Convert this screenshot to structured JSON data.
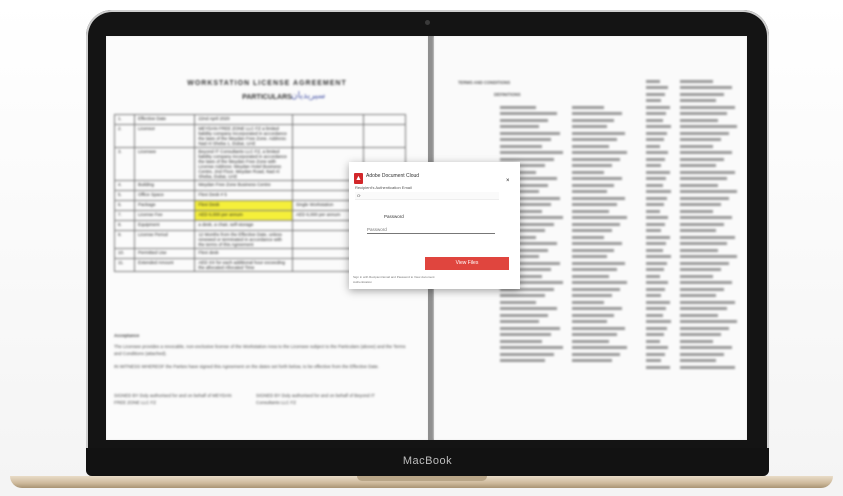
{
  "laptop": {
    "brand": "MacBook"
  },
  "document_left": {
    "title": "WORKSTATION LICENSE AGREEMENT",
    "subtitle": "PARTICULARS",
    "stamp": "سيريديان",
    "rows": [
      [
        "1.",
        "Effective Date",
        "22nd April 2020",
        "",
        ""
      ],
      [
        "2.",
        "Licensor",
        "MEYDAN FREE ZONE LLC FZ a limited liability company incorporated in accordance the laws of the Meydan Free Zone. Address: Nad Al Sheba 1, Dubai, UAE",
        "",
        ""
      ],
      [
        "3.",
        "Licensee",
        "Beyond IT Consultants LLC FZ, a limited liability company incorporated in accordance the laws of the Meydan Free Zone with License Address: Meydan Hotel Business Centre, 2nd Floor, Meydan Road, Nad Al Sheba, Dubai, UAE",
        "",
        ""
      ],
      [
        "4.",
        "Building",
        "Meydan Free Zone Business Centre",
        "",
        ""
      ],
      [
        "5.",
        "Office Space",
        "Flexi Desk # 5",
        "",
        ""
      ],
      [
        "6.",
        "Package",
        "Flexi Desk",
        "Single Workstation",
        ""
      ],
      [
        "7.",
        "License Fee",
        "AED 6,000 per annum",
        "AED 6,000 per annum",
        ""
      ],
      [
        "8.",
        "Equipment",
        "a desk, a chair, self-storage",
        "",
        ""
      ],
      [
        "9.",
        "License Period",
        "12 Months from the Effective Date, unless renewed or terminated in accordance with the terms of this Agreement",
        "",
        ""
      ],
      [
        "10.",
        "Permitted Use",
        "Flexi desk",
        "",
        ""
      ],
      [
        "11.",
        "Extended Amount",
        "AED XX for each additional hour exceeding the allocated Allocated Time",
        "",
        ""
      ]
    ],
    "acceptance_heading": "Acceptance",
    "acceptance_text": "The Licensee provides a revocable, non-exclusive license of the Workstation Area to the Licensee subject to the Particulars (above) and the Terms and Conditions (attached).",
    "witness_text": "IN WITNESS WHEREOF the Parties have signed this Agreement on the dates set forth below, to be effective from the Effective Date.",
    "signed_left": "SIGNED BY Duly authorised for and on behalf of MEYDAN FREE ZONE LLC FZ",
    "signed_right": "SIGNED BY Duly authorised for and on behalf of Beyond IT Consultants LLC FZ"
  },
  "document_right": {
    "heading": "TERMS AND CONDITIONS",
    "section": "DEFINITIONS"
  },
  "dialog": {
    "title": "Adobe Document Cloud",
    "close": "×",
    "recipient_label": "Recipient's Authentication Email",
    "email_value": "O·",
    "password_label": "Password",
    "password_placeholder": "Password",
    "button_label": "View Files",
    "note": "Sign in with Recipient Email and Password to View document",
    "note2": "Authentication"
  }
}
